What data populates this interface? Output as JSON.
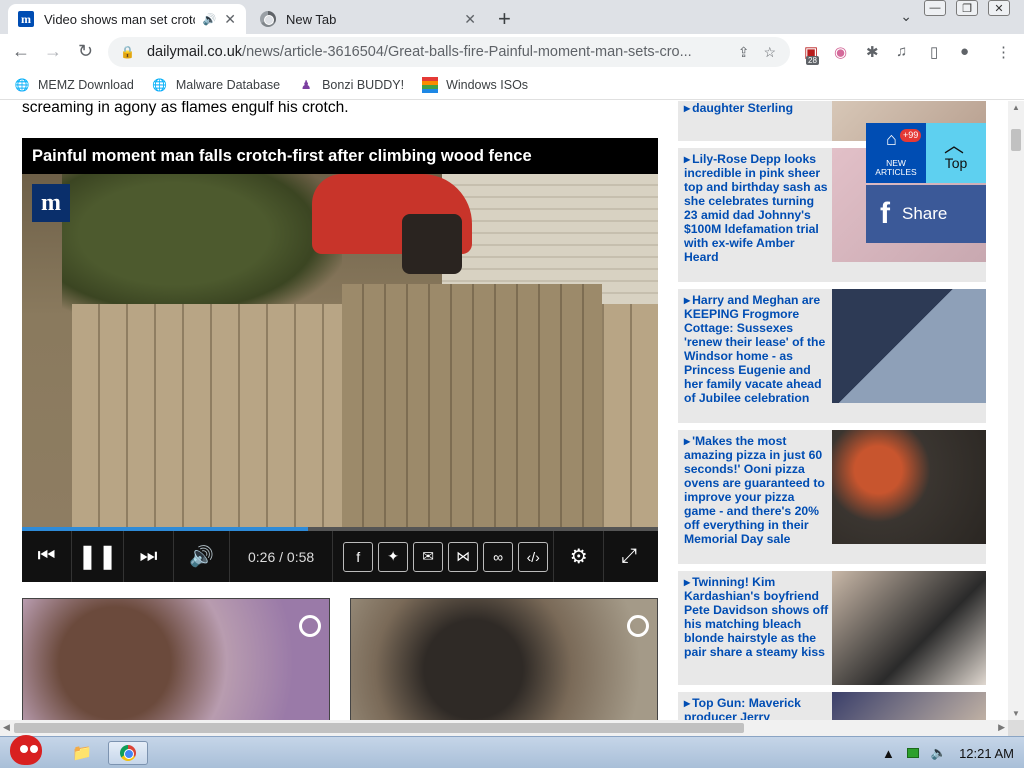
{
  "browser": {
    "tabs": [
      {
        "title": "Video shows man set crotch",
        "favicon": "dailymail-favicon",
        "audio": true,
        "active": true
      },
      {
        "title": "New Tab",
        "favicon": "chrome-favicon",
        "active": false
      }
    ],
    "new_tab_label": "+",
    "url": {
      "host": "dailymail.co.uk",
      "path": "/news/article-3616504/Great-balls-fire-Painful-moment-man-sets-cro..."
    },
    "extension_badge": "28",
    "bookmarks": [
      {
        "label": "MEMZ Download",
        "icon": "globe-icon"
      },
      {
        "label": "Malware Database",
        "icon": "globe-icon"
      },
      {
        "label": "Bonzi BUDDY!",
        "icon": "bonzi-icon"
      },
      {
        "label": "Windows ISOs",
        "icon": "windows-flag-icon"
      }
    ]
  },
  "article": {
    "lead_text": "screaming in agony as flames engulf his crotch.",
    "video": {
      "title": "Painful moment man falls crotch-first after climbing wood fence",
      "logo": "m",
      "current_time": "0:26",
      "duration": "0:58",
      "time_separator": "/",
      "progress_fraction": 0.45
    }
  },
  "sidebar": {
    "items": [
      {
        "text": "daughter Sterling",
        "image": "celebrity-photo"
      },
      {
        "text": "Lily-Rose Depp looks incredible in pink sheer top and birthday sash as she celebrates turning 23 amid dad Johnny's $100M ldefamation trial with ex-wife Amber Heard",
        "image": "lily-rose-photo"
      },
      {
        "text": "Harry and Meghan are KEEPING Frogmore Cottage: Sussexes 'renew their lease' of the Windsor home - as Princess Eugenie and her family vacate ahead of Jubilee celebration",
        "image": "eugenie-photo"
      },
      {
        "text": "'Makes the most amazing pizza in just 60 seconds!' Ooni pizza ovens are guaranteed to improve your pizza game - and there's 20% off everything in their Memorial Day sale",
        "image": "pizza-oven-photo"
      },
      {
        "text": "Twinning! Kim Kardashian's boyfriend Pete Davidson shows off his matching bleach blonde hairstyle as the pair share a steamy kiss",
        "image": "kardashian-photo"
      },
      {
        "text": "Top Gun: Maverick producer Jerry",
        "image": "top-gun-photo"
      }
    ]
  },
  "floating_nav": {
    "new_articles_badge": "+99",
    "new_articles_label": "NEW ARTICLES",
    "top_label": "Top",
    "share_label": "Share"
  },
  "taskbar": {
    "clock": "12:21 AM"
  }
}
